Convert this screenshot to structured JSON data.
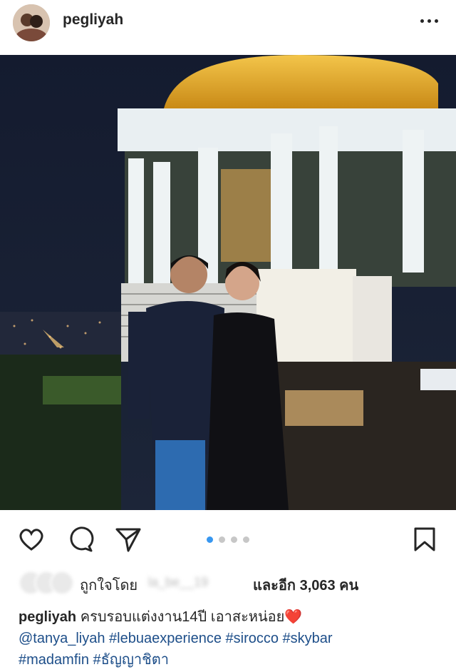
{
  "post": {
    "username": "pegliyah",
    "likes": {
      "liked_by_prefix": "ถูกใจโดย",
      "liked_by_user": "la_be__19",
      "and_more": "และอีก 3,063 คน"
    },
    "caption": {
      "user": "pegliyah",
      "text": "ครบรอบแต่งงาน14ปี เอาสะหน่อย",
      "emoji": "❤️",
      "line2": "@tanya_liyah #lebuaexperience #sirocco #skybar",
      "line3": "#madamfin #ธัญญาชิตา"
    },
    "carousel": {
      "total": 4,
      "active": 1
    }
  },
  "icons": [
    "avatar",
    "more-options-icon",
    "heart-icon",
    "comment-icon",
    "share-icon",
    "bookmark-icon"
  ],
  "colors": {
    "accent_blue": "#3897f0",
    "hashtag": "#1d4e89",
    "text": "#262626",
    "heart": "#e0233a"
  }
}
